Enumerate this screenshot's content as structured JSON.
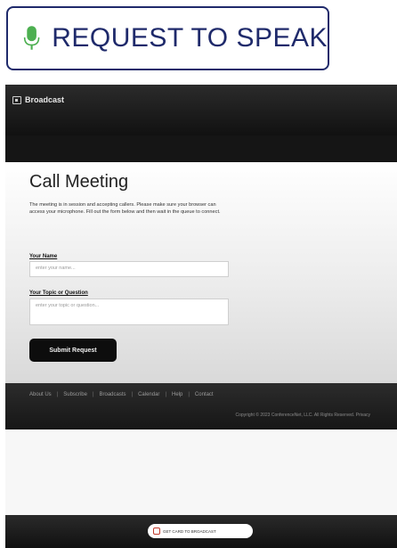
{
  "request_to_speak": {
    "label": "REQUEST TO SPEAK",
    "icon": "microphone-icon",
    "colors": {
      "border": "#1f2a6b",
      "text": "#1f2a6b",
      "icon": "#4caf50"
    }
  },
  "window": {
    "title": "Broadcast",
    "title_icon": "broadcast-icon"
  },
  "form": {
    "title": "Call Meeting",
    "description": "The meeting is in session and accepting callers. Please make sure your browser can access your microphone. Fill out the form below and then wait in the queue to connect.",
    "name_label": "Your Name",
    "name_placeholder": "enter your name...",
    "topic_label": "Your Topic or Question",
    "topic_placeholder": "enter your topic or question...",
    "submit_label": "Submit Request"
  },
  "footer": {
    "links": [
      "About Us",
      "Subscribe",
      "Broadcasts",
      "Calendar",
      "Help",
      "Contact"
    ],
    "copyright": "Copyright © 2023 ConferenceNet, LLC. All Rights Reserved. Privacy"
  },
  "bottom_bar": {
    "pill_label": "GET CARD TO BROADCAST",
    "pill_icon": "card-icon"
  }
}
